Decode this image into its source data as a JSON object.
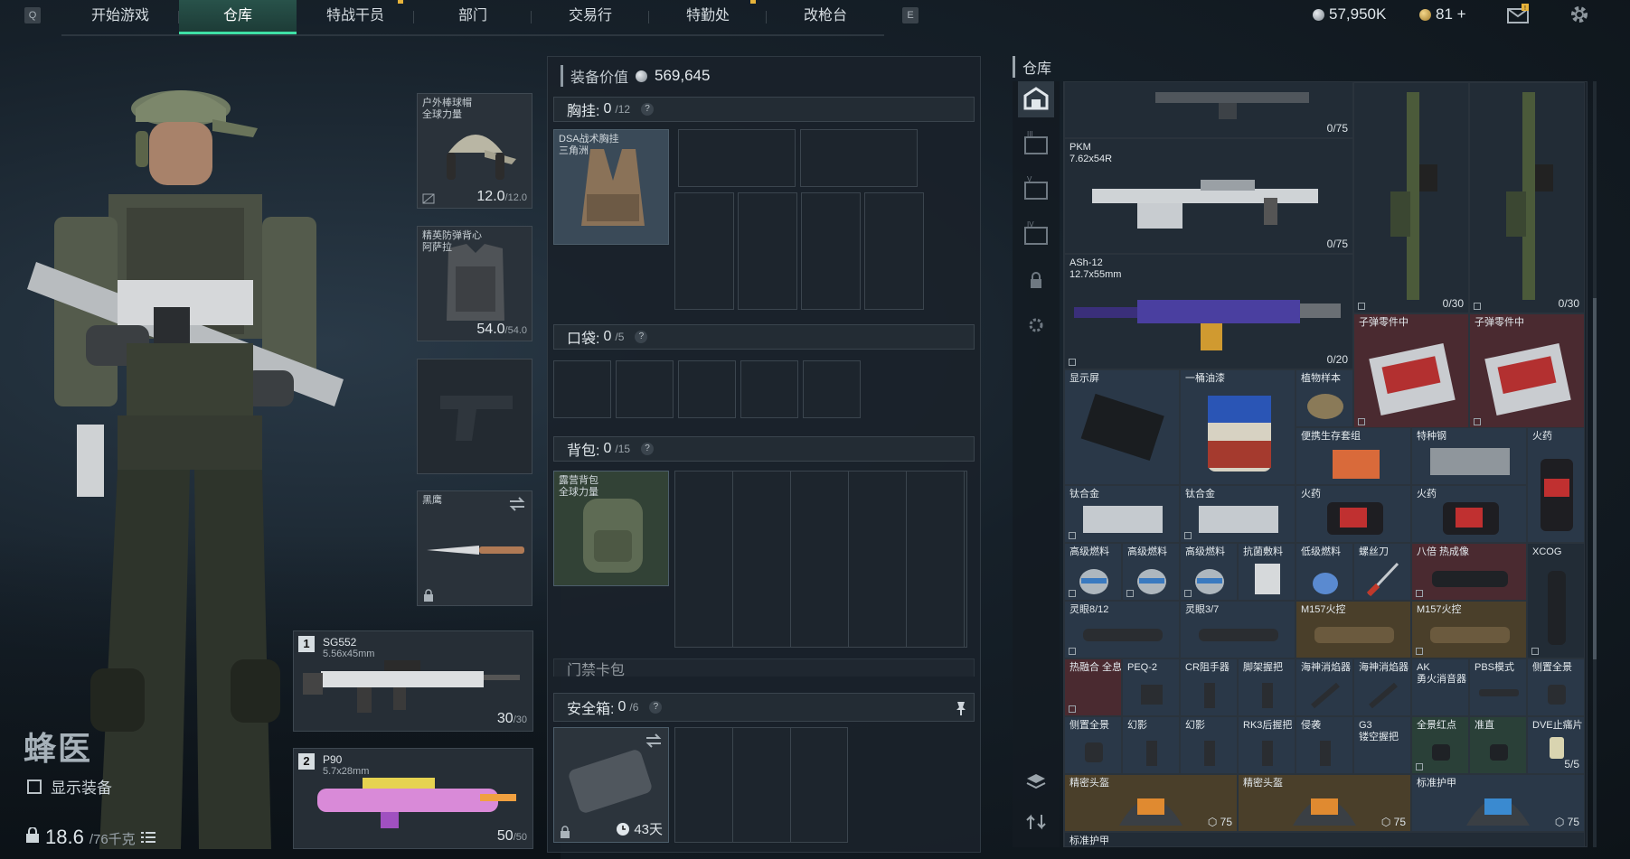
{
  "topbar": {
    "key_left": "Q",
    "key_right": "E",
    "tabs": [
      {
        "label": "开始游戏",
        "active": false,
        "notify": false
      },
      {
        "label": "仓库",
        "active": true,
        "notify": false
      },
      {
        "label": "特战干员",
        "active": false,
        "notify": true
      },
      {
        "label": "部门",
        "active": false,
        "notify": false
      },
      {
        "label": "交易行",
        "active": false,
        "notify": false
      },
      {
        "label": "特勤处",
        "active": false,
        "notify": true
      },
      {
        "label": "改枪台",
        "active": false,
        "notify": false
      }
    ],
    "currency_silver": "57,950K",
    "currency_gold": "81 +",
    "mail_badge": "!"
  },
  "operator": {
    "name": "蜂医",
    "show_equipment_label": "显示装备",
    "weight_value": "18.6",
    "weight_max": "/76千克"
  },
  "gear": {
    "helmet": {
      "label1": "户外棒球帽",
      "label2": "全球力量",
      "dur": "12.0",
      "dur_max": "/12.0"
    },
    "armor": {
      "label1": "精英防弹背心",
      "label2": "阿萨拉",
      "dur": "54.0",
      "dur_max": "/54.0"
    },
    "melee": {
      "label": "黑鹰"
    },
    "weapon1": {
      "num": "1",
      "name": "SG552",
      "caliber": "5.56x45mm",
      "ammo": "30",
      "ammo_max": "/30"
    },
    "weapon2": {
      "num": "2",
      "name": "P90",
      "caliber": "5.7x28mm",
      "ammo": "50",
      "ammo_max": "/50"
    }
  },
  "loadout": {
    "value_label": "装备价值",
    "value": "569,645",
    "chest": {
      "label": "胸挂:",
      "count": "0",
      "cap": "/12",
      "item_label1": "DSA战术胸挂",
      "item_label2": "三角洲"
    },
    "pocket": {
      "label": "口袋:",
      "count": "0",
      "cap": "/5"
    },
    "backpack": {
      "label": "背包:",
      "count": "0",
      "cap": "/15",
      "item_label1": "露营背包",
      "item_label2": "全球力量"
    },
    "keycard": {
      "label": "门禁卡包"
    },
    "safebox": {
      "label": "安全箱:",
      "count": "0",
      "cap": "/6",
      "days": "43天"
    }
  },
  "warehouse": {
    "title": "仓库",
    "items": [
      {
        "label": "",
        "count": "0/75",
        "color": "dark"
      },
      {
        "label": "PKM",
        "sub": "7.62x54R",
        "count": "0/75",
        "color": "dark"
      },
      {
        "label": "ASh-12",
        "sub": "12.7x55mm",
        "count": "0/20",
        "color": "dark"
      },
      {
        "label": "",
        "count": "0/30",
        "color": "dark"
      },
      {
        "label": "",
        "count": "0/30",
        "color": "dark"
      },
      {
        "label": "子弹零件中",
        "count": "",
        "color": "red"
      },
      {
        "label": "子弹零件中",
        "count": "",
        "color": "red"
      },
      {
        "label": "显示屏",
        "count": "",
        "color": "blue"
      },
      {
        "label": "一桶油漆",
        "count": "",
        "color": "blue"
      },
      {
        "label": "植物样本",
        "count": "",
        "color": "blue"
      },
      {
        "label": "便携生存套组",
        "count": "",
        "color": "blue"
      },
      {
        "label": "特种钢",
        "count": "",
        "color": "blue"
      },
      {
        "label": "火药",
        "count": "",
        "color": "blue"
      },
      {
        "label": "钛合金",
        "count": "",
        "color": "blue"
      },
      {
        "label": "钛合金",
        "count": "",
        "color": "blue"
      },
      {
        "label": "火药",
        "count": "",
        "color": "blue"
      },
      {
        "label": "火药",
        "count": "",
        "color": "blue"
      },
      {
        "label": "高级燃料",
        "count": "",
        "color": "blue"
      },
      {
        "label": "高级燃料",
        "count": "",
        "color": "blue"
      },
      {
        "label": "高级燃料",
        "count": "",
        "color": "blue"
      },
      {
        "label": "抗菌敷料",
        "count": "",
        "color": "blue"
      },
      {
        "label": "低级燃料",
        "count": "",
        "color": "blue"
      },
      {
        "label": "螺丝刀",
        "count": "",
        "color": "blue"
      },
      {
        "label": "八倍 热成像",
        "count": "",
        "color": "red"
      },
      {
        "label": "XCOG",
        "count": "",
        "color": "dark"
      },
      {
        "label": "灵眼8/12",
        "count": "",
        "color": "blue"
      },
      {
        "label": "灵眼3/7",
        "count": "",
        "color": "blue"
      },
      {
        "label": "M157火控",
        "count": "",
        "color": "gold"
      },
      {
        "label": "M157火控",
        "count": "",
        "color": "gold"
      },
      {
        "label": "热融合 全息",
        "count": "",
        "color": "red"
      },
      {
        "label": "PEQ-2",
        "count": "",
        "color": "blue"
      },
      {
        "label": "CR阻手器",
        "count": "",
        "color": "blue"
      },
      {
        "label": "脚架握把",
        "count": "",
        "color": "blue"
      },
      {
        "label": "海神消焰器",
        "count": "",
        "color": "blue"
      },
      {
        "label": "海神消焰器",
        "count": "",
        "color": "blue"
      },
      {
        "label": "AK",
        "sub": "勇火消音器",
        "count": "",
        "color": "blue"
      },
      {
        "label": "PBS模式",
        "count": "",
        "color": "blue"
      },
      {
        "label": "侧置全景",
        "count": "",
        "color": "blue"
      },
      {
        "label": "侧置全景",
        "count": "",
        "color": "blue"
      },
      {
        "label": "幻影",
        "count": "",
        "color": "blue"
      },
      {
        "label": "幻影",
        "count": "",
        "color": "blue"
      },
      {
        "label": "RK3后握把",
        "count": "",
        "color": "blue"
      },
      {
        "label": "侵袭",
        "count": "",
        "color": "blue"
      },
      {
        "label": "G3",
        "sub": "镂空握把",
        "count": "",
        "color": "blue"
      },
      {
        "label": "全景红点",
        "count": "",
        "color": "green"
      },
      {
        "label": "准直",
        "count": "",
        "color": "green"
      },
      {
        "label": "DVE止痛片",
        "count": "5/5",
        "color": "blue"
      },
      {
        "label": "精密头盔",
        "count": "75",
        "color": "gold"
      },
      {
        "label": "精密头盔",
        "count": "75",
        "color": "gold"
      },
      {
        "label": "标准护甲",
        "count": "75",
        "color": "blue"
      },
      {
        "label": "标准护甲",
        "count": "",
        "color": "dark"
      }
    ]
  },
  "colors": {
    "accent": "#3fe0a6",
    "tile_blue": "#2a3848",
    "tile_red": "#4a2a30",
    "tile_gold": "#4a3f2a",
    "tile_purple": "#3a3350"
  }
}
